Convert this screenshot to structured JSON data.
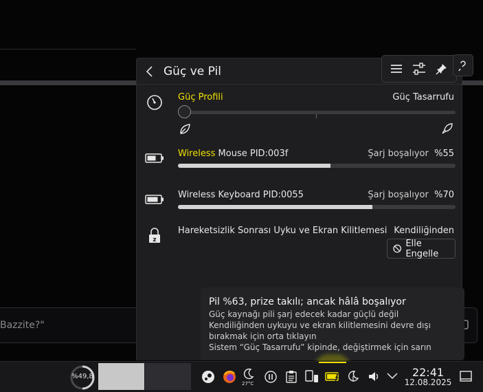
{
  "background": {
    "input_text": "Bazzite?\""
  },
  "popup": {
    "title": "Güç ve Pil",
    "icons": {
      "back": "chevron-left-icon",
      "menu": "hamburger-menu-icon",
      "configure": "sliders-icon",
      "pin": "pin-icon",
      "extra": "help-icon"
    }
  },
  "power_profile": {
    "label": "Güç Profili",
    "current": "Güç Tasarrufu",
    "value_index": 0,
    "steps": 3,
    "icon": "speedometer-icon",
    "left_icon": "leaf-icon",
    "right_icon": "rocket-icon"
  },
  "devices": [
    {
      "name_highlight": "Wireless",
      "name_rest": " Mouse PID:003f",
      "status": "Şarj boşalıyor",
      "percent_label": "%55",
      "percent": 55,
      "icon": "battery-icon"
    },
    {
      "name_highlight": "",
      "name_rest": "Wireless Keyboard PID:0055",
      "status": "Şarj boşalıyor",
      "percent_label": "%70",
      "percent": 70,
      "icon": "battery-icon"
    }
  ],
  "sleep": {
    "label": "Hareketsizlik Sonrası Uyku ve Ekran Kilitlemesi",
    "status": "Kendiliğinden",
    "button": "Elle Engelle",
    "icon": "lock-sleep-icon",
    "button_icon": "block-icon"
  },
  "tooltip": {
    "title": "Pil %63, prize takılı; ancak hâlâ boşalıyor",
    "lines": [
      "Güç kaynağı pili şarj edecek kadar güçlü değil",
      "Kendiliğinden uykuyu ve ekran kilitlemesini devre dışı",
      "bırakmak için orta tıklayın",
      "Sistem “Güç Tasarrufu” kipinde, değiştirmek için sarın"
    ]
  },
  "taskbar": {
    "cpu": "%49,8",
    "temperature": "27°C",
    "clock_time": "22:41",
    "clock_date": "12.08.2025",
    "accent": "#f0e000"
  }
}
